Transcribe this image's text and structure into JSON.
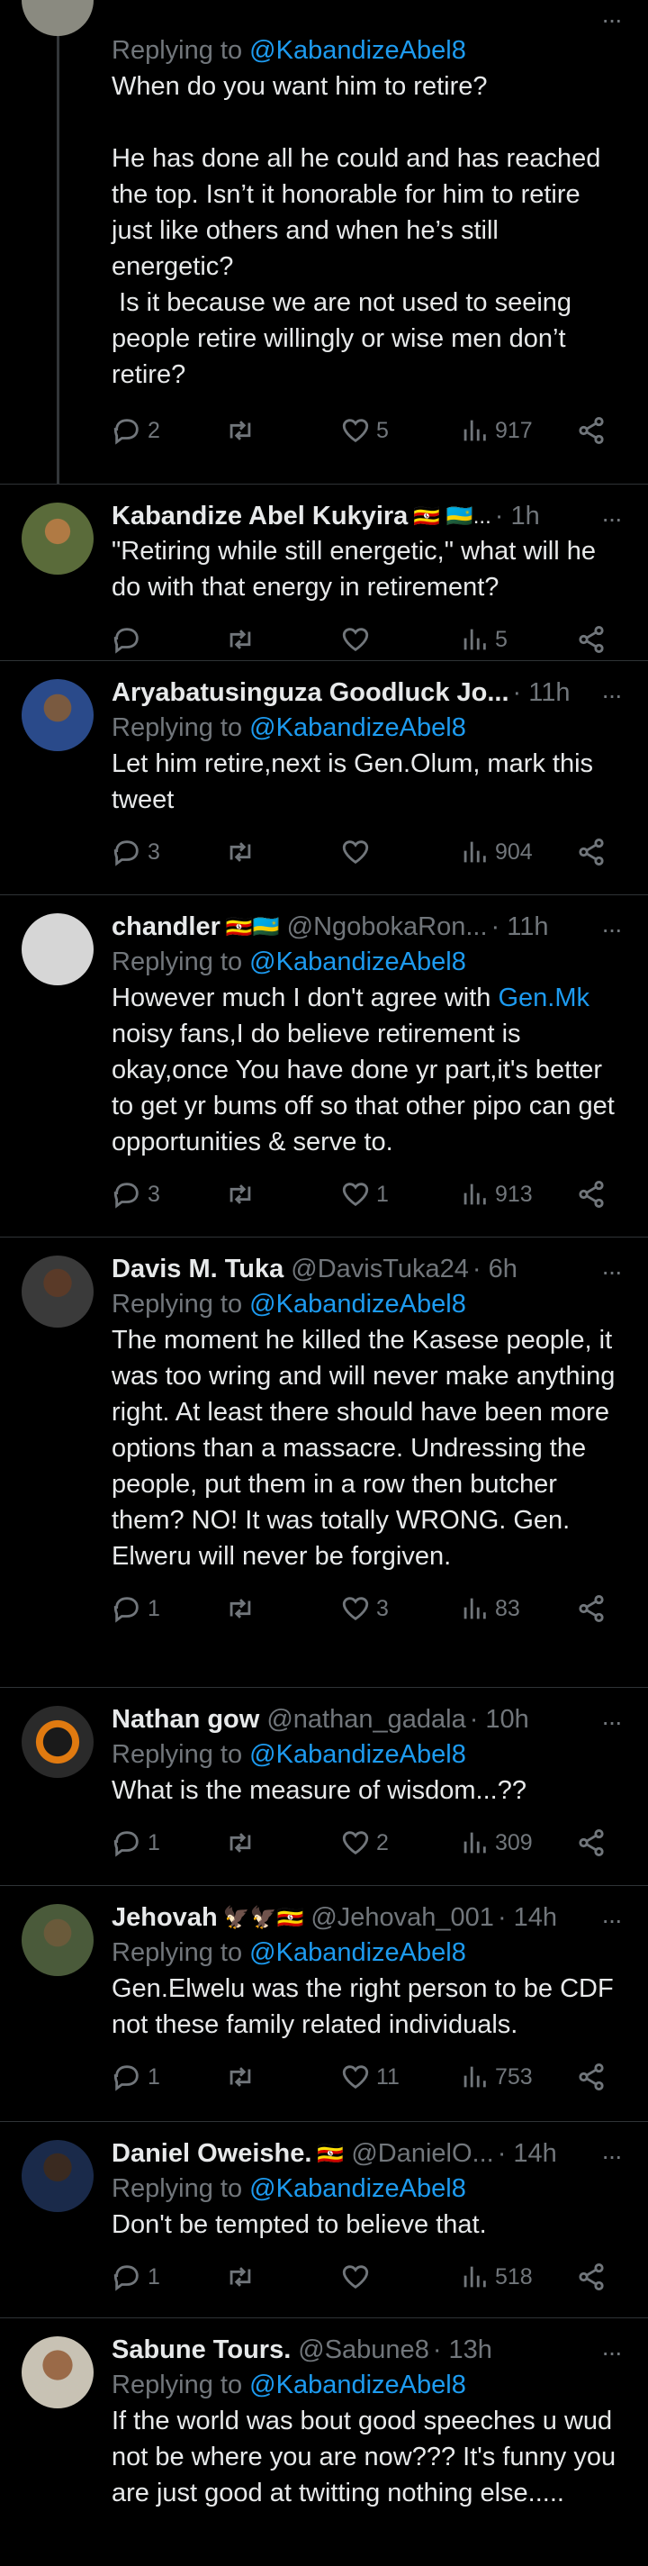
{
  "reply_prefix": "Replying to ",
  "tweets": [
    {
      "name": "",
      "flags": "",
      "handle": "",
      "time": "",
      "reply_to": "@KabandizeAbel8",
      "text": "When do you want him to retire?\n\nHe has done all he could and has reached the top. Isn’t it honorable for him to retire just like others and when he’s still energetic?\n Is it because we are not used to seeing people retire willingly or wise men don’t retire?",
      "replies": "2",
      "retweets": "",
      "likes": "5",
      "views": "917"
    },
    {
      "name": "Kabandize Abel Kukyira",
      "flags": "🇺🇬 🇷🇼...",
      "handle": "",
      "time": "· 1h",
      "reply_to": "",
      "text": "\"Retiring while still energetic,\" what will he do with that energy in retirement?",
      "replies": "",
      "retweets": "",
      "likes": "",
      "views": "5"
    },
    {
      "name": "Aryabatusinguza Goodluck Jo...",
      "flags": "",
      "handle": "",
      "time": "· 11h",
      "reply_to": "@KabandizeAbel8",
      "text": "Let him retire,next is Gen.Olum, mark this tweet",
      "replies": "3",
      "retweets": "",
      "likes": "",
      "views": "904"
    },
    {
      "name": "chandler",
      "flags": "🇺🇬🇷🇼",
      "handle": "@NgobokaRon...",
      "time": "· 11h",
      "reply_to": "@KabandizeAbel8",
      "text_before": "However much I don't agree with ",
      "text_link": "Gen.Mk",
      "text_after": "\nnoisy fans,I do believe retirement is okay,once You have done yr part,it's better to get yr bums off so that other pipo can get opportunities & serve to.",
      "replies": "3",
      "retweets": "",
      "likes": "1",
      "views": "913"
    },
    {
      "name": "Davis M. Tuka",
      "flags": "",
      "handle": "@DavisTuka24",
      "time": "· 6h",
      "reply_to": "@KabandizeAbel8",
      "text": "The moment he killed the Kasese people, it was too wring and will never make anything right. At least there should have been more options than a massacre. Undressing the people, put them in a row then butcher them? NO! It was totally WRONG. Gen. Elweru will never be forgiven.",
      "replies": "1",
      "retweets": "",
      "likes": "3",
      "views": "83"
    },
    {
      "name": "Nathan gow",
      "flags": "",
      "handle": "@nathan_gadala",
      "time": "· 10h",
      "reply_to": "@KabandizeAbel8",
      "text": "What is the measure of wisdom...??",
      "replies": "1",
      "retweets": "",
      "likes": "2",
      "views": "309"
    },
    {
      "name": "Jehovah",
      "flags": "🦅🦅🇺🇬",
      "handle": "@Jehovah_001",
      "time": "· 14h",
      "reply_to": "@KabandizeAbel8",
      "text": "Gen.Elwelu was the right person to be CDF not these family related individuals.",
      "replies": "1",
      "retweets": "",
      "likes": "11",
      "views": "753"
    },
    {
      "name": "Daniel Oweishe.",
      "flags": "🇺🇬",
      "handle": "@DanielO...",
      "time": "· 14h",
      "reply_to": "@KabandizeAbel8",
      "text": "Don't be tempted to believe that.",
      "replies": "1",
      "retweets": "",
      "likes": "",
      "views": "518"
    },
    {
      "name": "Sabune Tours.",
      "flags": "",
      "handle": "@Sabune8",
      "time": "· 13h",
      "reply_to": "@KabandizeAbel8",
      "text": "If the world was bout good speeches u wud not be where you are now??? It's funny you are just good at twitting nothing else.....",
      "replies": "",
      "retweets": "",
      "likes": "",
      "views": ""
    }
  ],
  "colors": {
    "background": "#000000",
    "text": "#e7e9ea",
    "muted": "#71767b",
    "link": "#1d9bf0",
    "divider": "#2f3336"
  },
  "icons": [
    "reply-icon",
    "retweet-icon",
    "like-icon",
    "views-icon",
    "share-icon",
    "more-icon"
  ]
}
